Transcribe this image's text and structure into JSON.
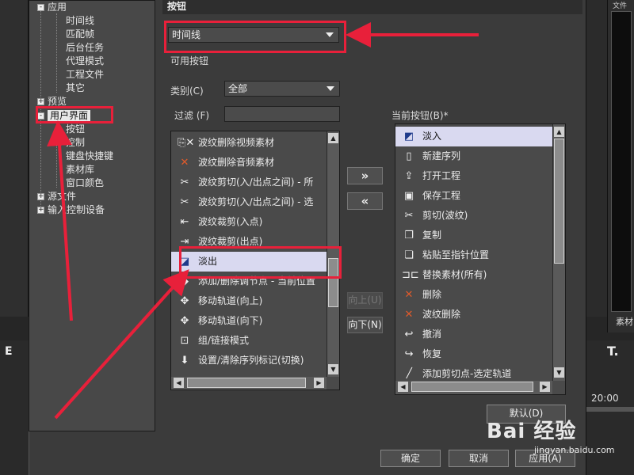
{
  "background": {
    "right_panel_header": "文件",
    "right_panel_footer": "素材",
    "left_label": "E",
    "tool_label": "T.",
    "timecode": "20:00"
  },
  "tree": {
    "items": [
      {
        "label": "应用",
        "toggle": "-"
      },
      {
        "label": "时间线"
      },
      {
        "label": "匹配帧"
      },
      {
        "label": "后台任务"
      },
      {
        "label": "代理模式"
      },
      {
        "label": "工程文件"
      },
      {
        "label": "其它"
      },
      {
        "label": "预览",
        "toggle": "+"
      },
      {
        "label": "用户界面",
        "toggle": "-"
      },
      {
        "label": "按钮"
      },
      {
        "label": "控制"
      },
      {
        "label": "键盘快捷键"
      },
      {
        "label": "素材库"
      },
      {
        "label": "窗口颜色"
      },
      {
        "label": "源文件",
        "toggle": "+"
      },
      {
        "label": "输入控制设备",
        "toggle": "+"
      }
    ]
  },
  "panel": {
    "title": "按钮",
    "target_select": "时间线",
    "available_label": "可用按钮",
    "category_label": "类别(C)",
    "category_value": "全部",
    "filter_label": "过滤 (F)",
    "filter_value": "",
    "current_label": "当前按钮(B)*"
  },
  "available": [
    {
      "label": "波纹删除视频素材",
      "icon": "ripple-delete-video-icon"
    },
    {
      "label": "波纹删除音频素材",
      "icon": "ripple-delete-audio-icon"
    },
    {
      "label": "波纹剪切(入/出点之间) - 所",
      "icon": "ripple-cut-all-icon"
    },
    {
      "label": "波纹剪切(入/出点之间) - 选",
      "icon": "ripple-cut-selected-icon"
    },
    {
      "label": "波纹裁剪(入点)",
      "icon": "ripple-trim-in-icon"
    },
    {
      "label": "波纹裁剪(出点)",
      "icon": "ripple-trim-out-icon"
    },
    {
      "label": "淡出",
      "icon": "fade-out-icon"
    },
    {
      "label": "添加/删除调节点 - 当前位置",
      "icon": "keyframe-icon"
    },
    {
      "label": "移动轨道(向上)",
      "icon": "track-up-icon"
    },
    {
      "label": "移动轨道(向下)",
      "icon": "track-down-icon"
    },
    {
      "label": "组/链接模式",
      "icon": "group-link-icon"
    },
    {
      "label": "设置/清除序列标记(切换)",
      "icon": "marker-icon"
    }
  ],
  "current": [
    {
      "label": "淡入",
      "icon": "fade-in-icon"
    },
    {
      "label": "新建序列",
      "icon": "new-sequence-icon"
    },
    {
      "label": "打开工程",
      "icon": "open-project-icon"
    },
    {
      "label": "保存工程",
      "icon": "save-project-icon"
    },
    {
      "label": "剪切(波纹)",
      "icon": "scissors-icon"
    },
    {
      "label": "复制",
      "icon": "copy-icon"
    },
    {
      "label": "粘贴至指针位置",
      "icon": "paste-icon"
    },
    {
      "label": "替换素材(所有)",
      "icon": "replace-clip-icon"
    },
    {
      "label": "删除",
      "icon": "delete-icon"
    },
    {
      "label": "波纹删除",
      "icon": "ripple-delete-icon"
    },
    {
      "label": "撤消",
      "icon": "undo-icon"
    },
    {
      "label": "恢复",
      "icon": "redo-icon"
    },
    {
      "label": "添加剪切点-选定轨道",
      "icon": "add-cut-icon"
    }
  ],
  "buttons": {
    "add": "»",
    "remove": "«",
    "up": "向上(U)",
    "down": "向下(N)",
    "default": "默认(D)",
    "ok": "确定",
    "cancel": "取消",
    "apply": "应用(A)"
  },
  "watermark": {
    "brand": "Bai 经验",
    "url": "jingyan.baidu.com"
  },
  "colors": {
    "highlight": "#e8203a",
    "selection": "#d9d9f0"
  }
}
